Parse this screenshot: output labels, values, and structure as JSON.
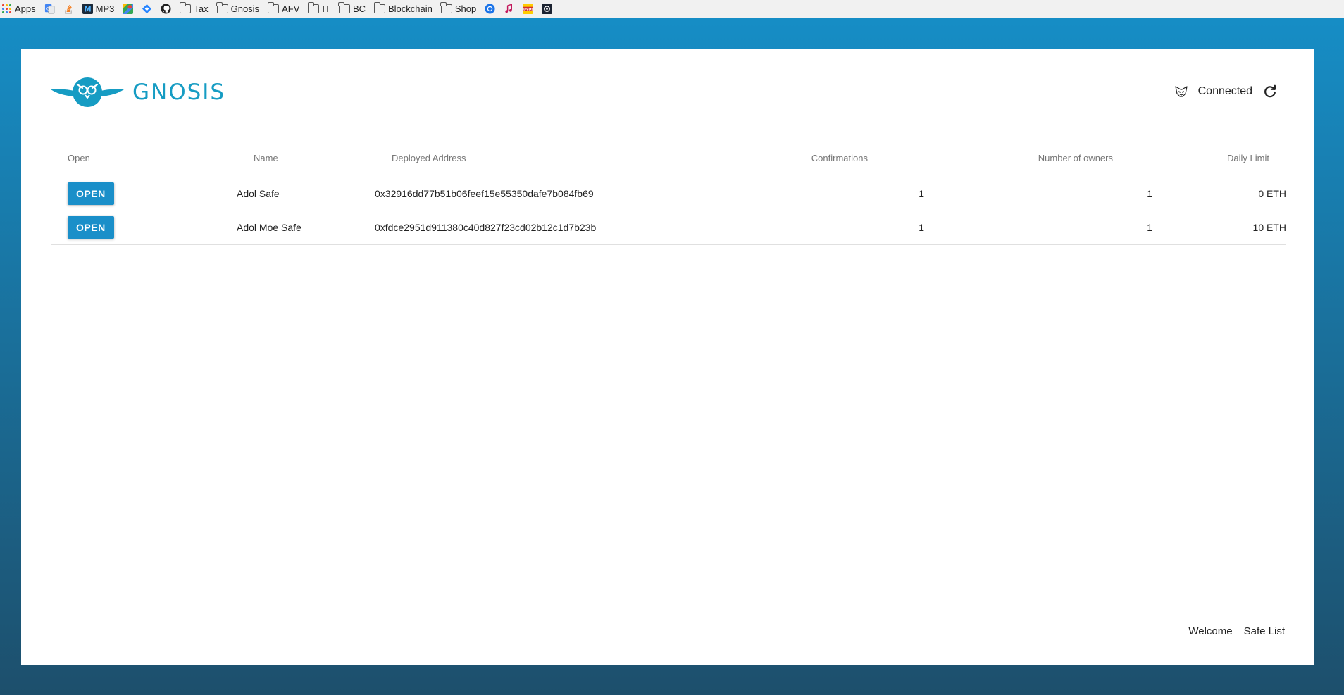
{
  "bookmarks": {
    "apps": "Apps",
    "mp3": "MP3",
    "folders": [
      "Tax",
      "Gnosis",
      "AFV",
      "IT",
      "BC",
      "Blockchain",
      "Shop"
    ],
    "icons": [
      "translate-icon",
      "stackoverflow-icon",
      "maps-icon",
      "jira-icon",
      "github-icon",
      "chrome-icon",
      "music-icon",
      "dvds-icon",
      "dark-app-icon"
    ]
  },
  "header": {
    "logo_text": "GNOSIS",
    "status": "Connected"
  },
  "table": {
    "headers": {
      "open": "Open",
      "name": "Name",
      "address": "Deployed Address",
      "confirmations": "Confirmations",
      "owners": "Number of owners",
      "daily_limit": "Daily Limit"
    },
    "rows": [
      {
        "button": "OPEN",
        "name": "Adol Safe",
        "address": "0x32916dd77b51b06feef15e55350dafe7b084fb69",
        "confirmations": "1",
        "owners": "1",
        "daily_limit": "0 ETH"
      },
      {
        "button": "OPEN",
        "name": "Adol Moe Safe",
        "address": "0xfdce2951d911380c40d827f23cd02b12c1d7b23b",
        "confirmations": "1",
        "owners": "1",
        "daily_limit": "10 ETH"
      }
    ]
  },
  "footer": {
    "welcome": "Welcome",
    "safe_list": "Safe List"
  },
  "colors": {
    "brand": "#169cc3",
    "button": "#1a8fc9",
    "background_top": "#168fc8",
    "background_bottom": "#1d4f6c"
  }
}
